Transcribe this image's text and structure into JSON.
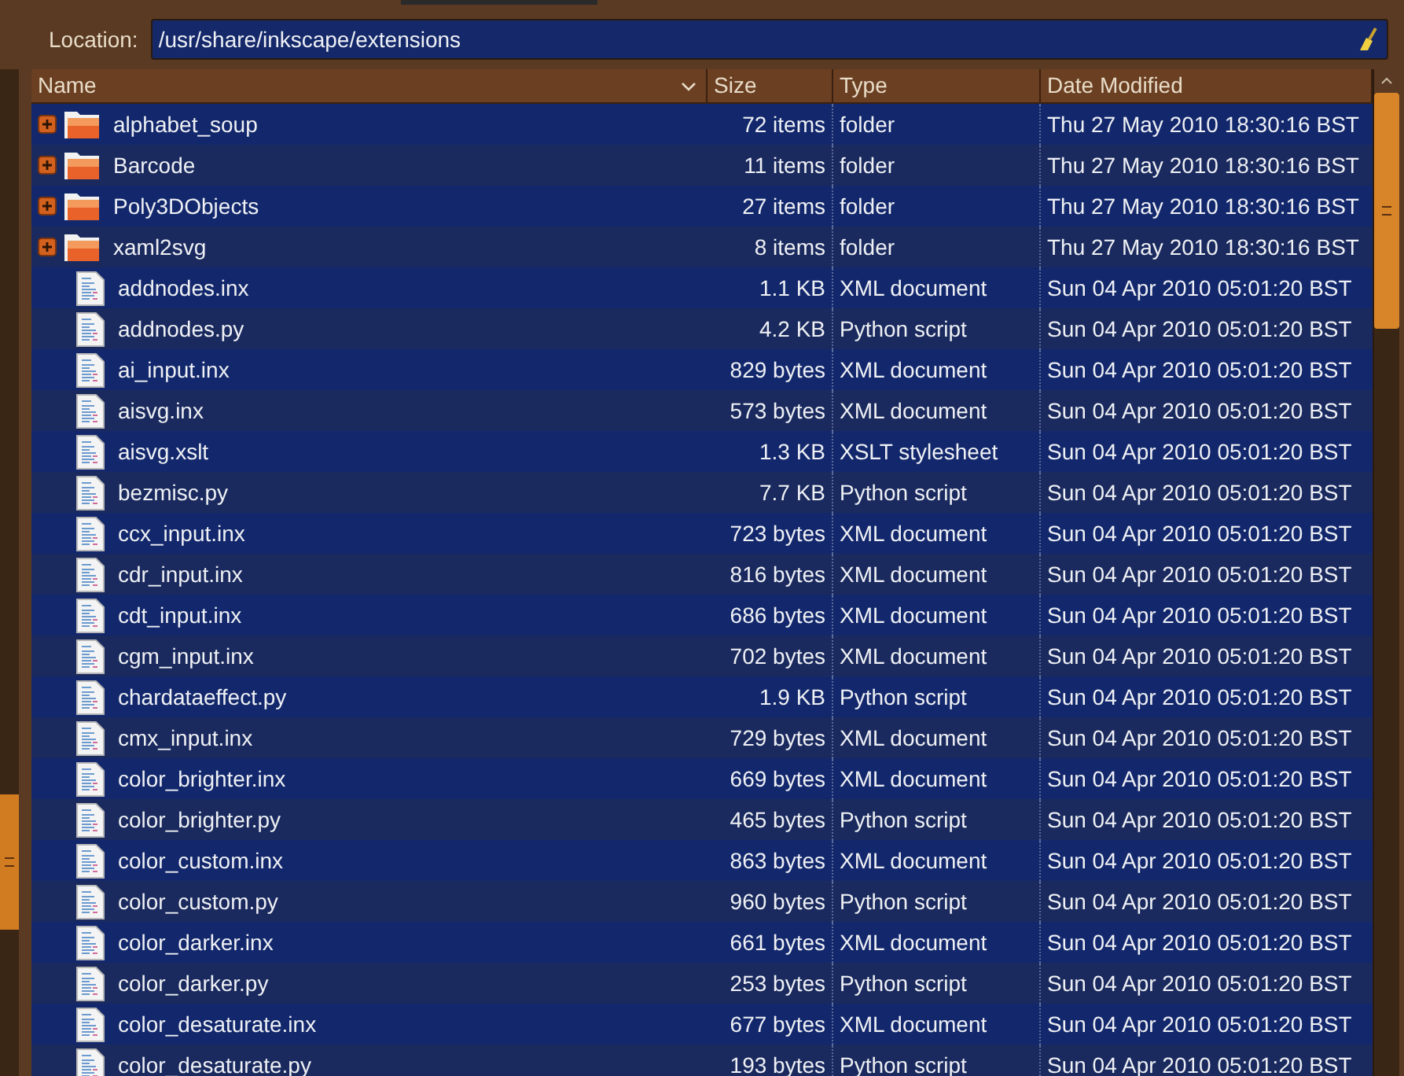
{
  "location": {
    "label": "Location:",
    "value": "/usr/share/inkscape/extensions"
  },
  "table": {
    "columns": [
      "Name",
      "Size",
      "Type",
      "Date Modified"
    ],
    "rows": [
      {
        "kind": "folder",
        "name": "alphabet_soup",
        "size": "72 items",
        "type": "folder",
        "date": "Thu 27 May 2010 18:30:16 BST"
      },
      {
        "kind": "folder",
        "name": "Barcode",
        "size": "11 items",
        "type": "folder",
        "date": "Thu 27 May 2010 18:30:16 BST"
      },
      {
        "kind": "folder",
        "name": "Poly3DObjects",
        "size": "27 items",
        "type": "folder",
        "date": "Thu 27 May 2010 18:30:16 BST"
      },
      {
        "kind": "folder",
        "name": "xaml2svg",
        "size": "8 items",
        "type": "folder",
        "date": "Thu 27 May 2010 18:30:16 BST"
      },
      {
        "kind": "file",
        "name": "addnodes.inx",
        "size": "1.1 KB",
        "type": "XML document",
        "date": "Sun 04 Apr 2010 05:01:20 BST"
      },
      {
        "kind": "file",
        "name": "addnodes.py",
        "size": "4.2 KB",
        "type": "Python script",
        "date": "Sun 04 Apr 2010 05:01:20 BST"
      },
      {
        "kind": "file",
        "name": "ai_input.inx",
        "size": "829 bytes",
        "type": "XML document",
        "date": "Sun 04 Apr 2010 05:01:20 BST"
      },
      {
        "kind": "file",
        "name": "aisvg.inx",
        "size": "573 bytes",
        "type": "XML document",
        "date": "Sun 04 Apr 2010 05:01:20 BST"
      },
      {
        "kind": "file",
        "name": "aisvg.xslt",
        "size": "1.3 KB",
        "type": "XSLT stylesheet",
        "date": "Sun 04 Apr 2010 05:01:20 BST"
      },
      {
        "kind": "file",
        "name": "bezmisc.py",
        "size": "7.7 KB",
        "type": "Python script",
        "date": "Sun 04 Apr 2010 05:01:20 BST"
      },
      {
        "kind": "file",
        "name": "ccx_input.inx",
        "size": "723 bytes",
        "type": "XML document",
        "date": "Sun 04 Apr 2010 05:01:20 BST"
      },
      {
        "kind": "file",
        "name": "cdr_input.inx",
        "size": "816 bytes",
        "type": "XML document",
        "date": "Sun 04 Apr 2010 05:01:20 BST"
      },
      {
        "kind": "file",
        "name": "cdt_input.inx",
        "size": "686 bytes",
        "type": "XML document",
        "date": "Sun 04 Apr 2010 05:01:20 BST"
      },
      {
        "kind": "file",
        "name": "cgm_input.inx",
        "size": "702 bytes",
        "type": "XML document",
        "date": "Sun 04 Apr 2010 05:01:20 BST"
      },
      {
        "kind": "file",
        "name": "chardataeffect.py",
        "size": "1.9 KB",
        "type": "Python script",
        "date": "Sun 04 Apr 2010 05:01:20 BST"
      },
      {
        "kind": "file",
        "name": "cmx_input.inx",
        "size": "729 bytes",
        "type": "XML document",
        "date": "Sun 04 Apr 2010 05:01:20 BST"
      },
      {
        "kind": "file",
        "name": "color_brighter.inx",
        "size": "669 bytes",
        "type": "XML document",
        "date": "Sun 04 Apr 2010 05:01:20 BST"
      },
      {
        "kind": "file",
        "name": "color_brighter.py",
        "size": "465 bytes",
        "type": "Python script",
        "date": "Sun 04 Apr 2010 05:01:20 BST"
      },
      {
        "kind": "file",
        "name": "color_custom.inx",
        "size": "863 bytes",
        "type": "XML document",
        "date": "Sun 04 Apr 2010 05:01:20 BST"
      },
      {
        "kind": "file",
        "name": "color_custom.py",
        "size": "960 bytes",
        "type": "Python script",
        "date": "Sun 04 Apr 2010 05:01:20 BST"
      },
      {
        "kind": "file",
        "name": "color_darker.inx",
        "size": "661 bytes",
        "type": "XML document",
        "date": "Sun 04 Apr 2010 05:01:20 BST"
      },
      {
        "kind": "file",
        "name": "color_darker.py",
        "size": "253 bytes",
        "type": "Python script",
        "date": "Sun 04 Apr 2010 05:01:20 BST"
      },
      {
        "kind": "file",
        "name": "color_desaturate.inx",
        "size": "677 bytes",
        "type": "XML document",
        "date": "Sun 04 Apr 2010 05:01:20 BST"
      },
      {
        "kind": "file",
        "name": "color_desaturate.py",
        "size": "193 bytes",
        "type": "Python script",
        "date": "Sun 04 Apr 2010 05:01:20 BST"
      }
    ]
  }
}
